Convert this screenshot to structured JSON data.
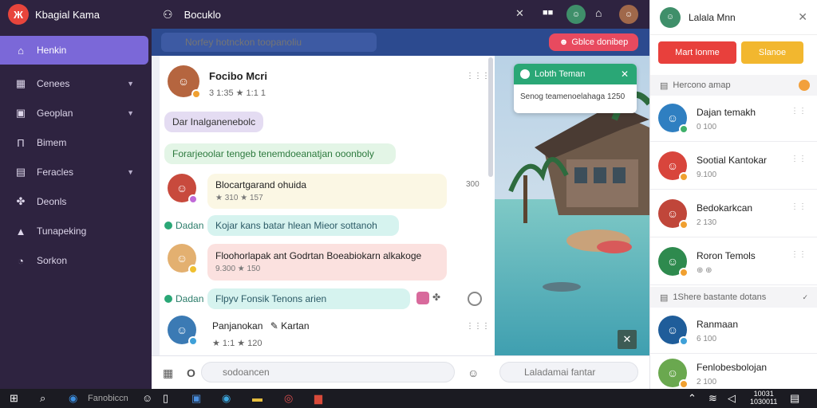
{
  "app": {
    "logo_text": "Ж",
    "title": "Kbagial Kama"
  },
  "sidebar": {
    "items": [
      {
        "label": "Henkin",
        "icon": "home-icon",
        "active": true
      },
      {
        "label": "Cenees",
        "icon": "grid-icon",
        "chevron": true
      },
      {
        "label": "Geoplan",
        "icon": "lock-icon",
        "chevron": true
      },
      {
        "label": "Bimem",
        "icon": "building-icon"
      },
      {
        "label": "Feracles",
        "icon": "calendar-icon",
        "chevron": true
      },
      {
        "label": "Deonls",
        "icon": "puzzle-icon"
      },
      {
        "label": "Tunapeking",
        "icon": "upload-icon"
      },
      {
        "label": "Sorkon",
        "icon": "clock-icon"
      }
    ]
  },
  "topbar": {
    "title": "Bocuklo"
  },
  "search": {
    "placeholder": "Norfey hotnckon toopanoliu",
    "button_label": "Gblce donibep"
  },
  "chat": {
    "header_name": "Focibo Mcri",
    "header_meta": "3 1:35  ★ 1:1 1",
    "header_time": "⋮⋮⋮",
    "bubble_purple": "Dar Inalganenebolc",
    "bubble_green": "Forarjeoolar tengeb tenemdoeanatjan ooonboly",
    "msg1": {
      "text": "Blocartgarand ohuida",
      "meta": "★ 310  ★ 157",
      "time": "300"
    },
    "sys1": {
      "label": "Dadan",
      "text": "Kojar kans batar hlean Mieor sottanoh"
    },
    "msg2": {
      "text": "Floohorlapak ant Godrtan Boeabiokarn alkakoge",
      "meta": "9.300  ★ 150"
    },
    "sys2": {
      "label": "Dadan",
      "text": "Flpyv Fonsik Tenons arien"
    },
    "msg3": {
      "name": "Panjanokan",
      "name2": "Kartan",
      "meta": "★ 1:1  ★ 120",
      "time": "⋮⋮⋮"
    }
  },
  "toast": {
    "title": "Lobth Teman",
    "body": "Senog teamenoelahaga 1250"
  },
  "composer": {
    "placeholder": "sodoancen",
    "right_placeholder": "Laladamai fantar"
  },
  "rpanel": {
    "title": "Lalala Mnn",
    "btn_red": "Mart Ionme",
    "btn_yellow": "Slanoe",
    "section1": "Hercono amap",
    "section2": "1Shere bastante dotans",
    "contacts": [
      {
        "name": "Dajan temakh",
        "sub": "0 100",
        "color": "#2f7fc1"
      },
      {
        "name": "Sootial Kantokar",
        "sub": "9.100",
        "color": "#d8453c"
      },
      {
        "name": "Bedokarkcan",
        "sub": "2 130",
        "color": "#c0463a"
      },
      {
        "name": "Roron Temols",
        "sub": "⊕ ⊕",
        "color": "#2e8a4e"
      },
      {
        "name": "Ranmaan",
        "sub": "6 100",
        "color": "#1f5d9a"
      },
      {
        "name": "Fenlobesbolojan",
        "sub": "2 100",
        "color": "#6aa84f"
      }
    ]
  },
  "taskbar": {
    "label": "Fanobiccn",
    "clock_time": "10031",
    "clock_date": "1030011"
  }
}
